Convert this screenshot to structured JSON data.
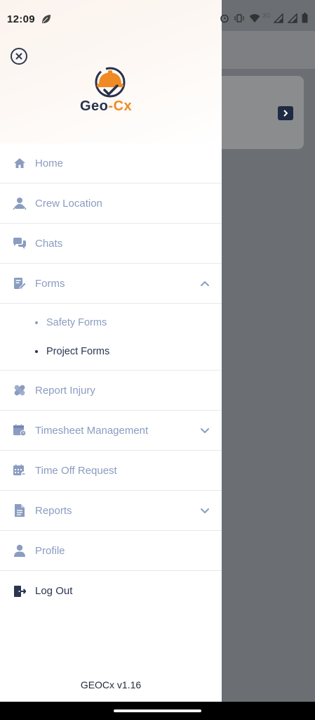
{
  "status_bar": {
    "time": "12:09",
    "network_label": "3G"
  },
  "background": {
    "arrow_icon": "chevron-right-icon"
  },
  "drawer": {
    "close_icon": "close-icon",
    "logo": {
      "text_part1": "Geo",
      "text_dash": "-",
      "text_part2": "Cx"
    },
    "menu": [
      {
        "key": "home",
        "label": "Home",
        "icon": "home-icon"
      },
      {
        "key": "crew_location",
        "label": "Crew Location",
        "icon": "crew-location-icon"
      },
      {
        "key": "chats",
        "label": "Chats",
        "icon": "chats-icon"
      },
      {
        "key": "forms",
        "label": "Forms",
        "icon": "forms-icon",
        "expanded": true,
        "children": [
          {
            "label": "Safety Forms",
            "active": false
          },
          {
            "label": "Project Forms",
            "active": true
          }
        ]
      },
      {
        "key": "report_injury",
        "label": "Report Injury",
        "icon": "bandage-icon"
      },
      {
        "key": "timesheet",
        "label": "Timesheet Management",
        "icon": "timesheet-icon",
        "expandable": true
      },
      {
        "key": "time_off",
        "label": "Time Off Request",
        "icon": "calendar-icon"
      },
      {
        "key": "reports",
        "label": "Reports",
        "icon": "reports-icon",
        "expandable": true
      },
      {
        "key": "profile",
        "label": "Profile",
        "icon": "profile-icon"
      },
      {
        "key": "logout",
        "label": "Log Out",
        "icon": "logout-icon"
      }
    ],
    "version": "GEOCx v1.16"
  },
  "colors": {
    "muted_text": "#8a9cc0",
    "active_text": "#2a3550",
    "brand_orange": "#f08a24",
    "brand_navy": "#27324d"
  }
}
